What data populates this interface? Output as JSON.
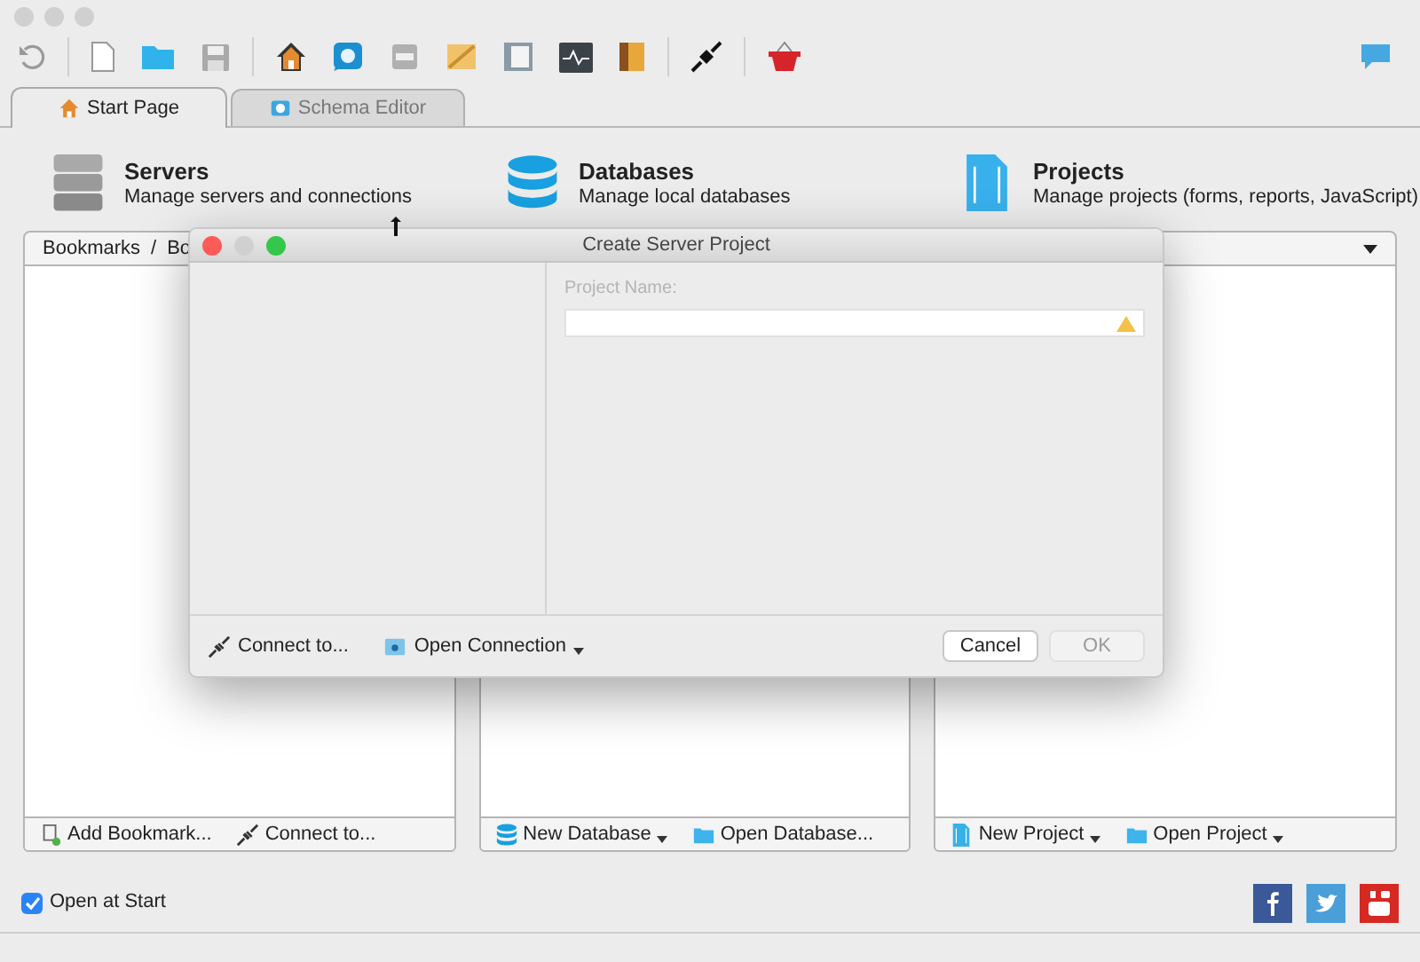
{
  "tabs": [
    {
      "label": "Start Page",
      "selected": true,
      "kind": "home"
    },
    {
      "label": "Schema Editor",
      "selected": false,
      "kind": "schema"
    }
  ],
  "sections": [
    {
      "title": "Servers",
      "subtitle": "Manage servers and connections",
      "kind": "server"
    },
    {
      "title": "Databases",
      "subtitle": "Manage local databases",
      "kind": "database"
    },
    {
      "title": "Projects",
      "subtitle": "Manage projects (forms, reports, JavaScript)",
      "kind": "project"
    }
  ],
  "panels": [
    {
      "breadcrumb": [
        "Bookmarks",
        "/",
        "Bo"
      ],
      "actions": [
        {
          "label": "Add Bookmark...",
          "kind": "bookmark",
          "dropdown": false
        },
        {
          "label": "Connect to...",
          "kind": "plug",
          "dropdown": false
        }
      ]
    },
    {
      "actions": [
        {
          "label": "New Database",
          "kind": "database",
          "dropdown": true
        },
        {
          "label": "Open Database...",
          "kind": "folder",
          "dropdown": false
        }
      ]
    },
    {
      "actions": [
        {
          "label": "New Project",
          "kind": "project",
          "dropdown": true
        },
        {
          "label": "Open Project",
          "kind": "folder",
          "dropdown": true
        }
      ]
    }
  ],
  "open_at_start": {
    "label": "Open at Start",
    "checked": true
  },
  "dialog": {
    "title": "Create Server Project",
    "field_label": "Project Name:",
    "warning": true,
    "footer_actions": [
      {
        "label": "Connect to...",
        "kind": "plug",
        "dropdown": false
      },
      {
        "label": "Open Connection",
        "kind": "connection",
        "dropdown": true
      }
    ],
    "buttons": [
      {
        "label": "Cancel",
        "disabled": false
      },
      {
        "label": "OK",
        "disabled": true
      }
    ]
  }
}
